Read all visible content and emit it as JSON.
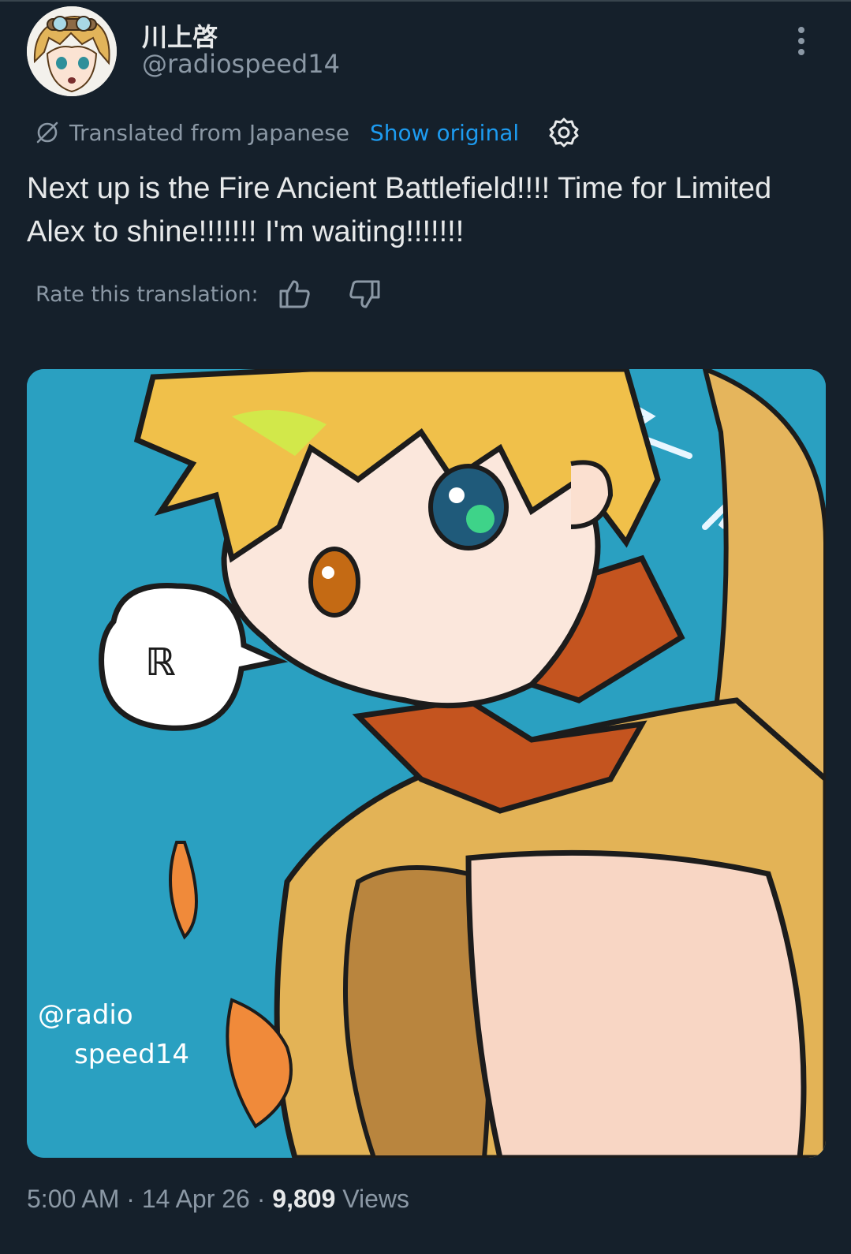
{
  "author": {
    "display_name": "川上啓",
    "handle": "@radiospeed14"
  },
  "translation": {
    "label": "Translated from Japanese",
    "show_original": "Show original"
  },
  "tweet": {
    "text": "Next up is the Fire Ancient Battlefield!!!! Time for Limited Alex to shine!!!!!!! I'm waiting!!!!!!!"
  },
  "rating": {
    "label": "Rate this translation:"
  },
  "meta": {
    "time": "5:00 AM",
    "date": "14 Apr 26",
    "separator": "·",
    "views_count": "9,809",
    "views_label": "Views"
  },
  "media": {
    "watermark": "@radio speed14",
    "speech_bubble": "ℝ"
  },
  "colors": {
    "background": "#15202b",
    "accent": "#1d9bf0",
    "secondary_text": "#8b98a5",
    "primary_text": "#e7e9ea",
    "illustration_bg": "#2aa0c1"
  }
}
